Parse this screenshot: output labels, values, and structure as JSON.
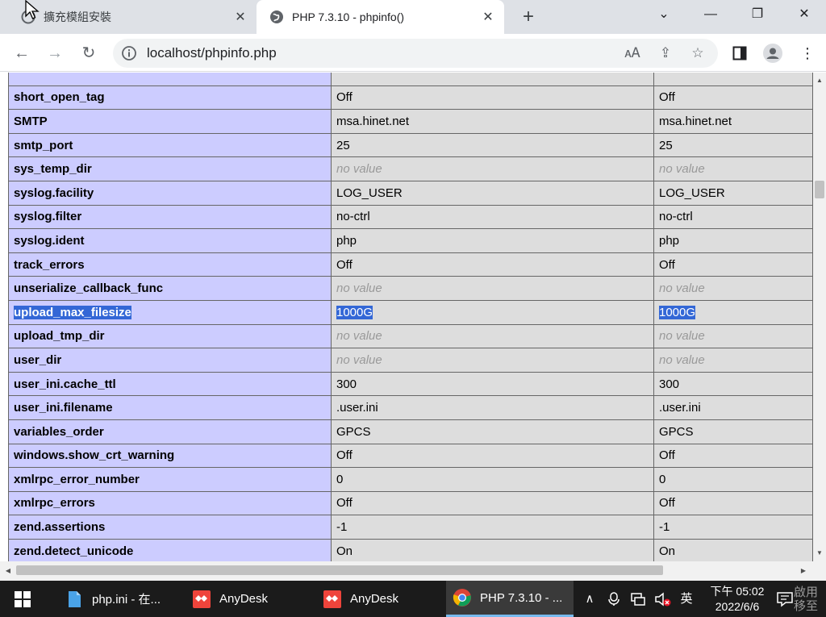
{
  "browser": {
    "tabs": [
      {
        "title": "擴充模組安裝",
        "active": false
      },
      {
        "title": "PHP 7.3.10 - phpinfo()",
        "active": true
      }
    ],
    "url": "localhost/phpinfo.php"
  },
  "colors": {
    "directive_bg": "#ccccff",
    "value_bg": "#dddddd",
    "selection": "#3367d6",
    "taskbar": "#1b1b1b"
  },
  "phpinfo": {
    "rows": [
      {
        "directive": "",
        "local": "",
        "master": ""
      },
      {
        "directive": "short_open_tag",
        "local": "Off",
        "master": "Off"
      },
      {
        "directive": "SMTP",
        "local": "msa.hinet.net",
        "master": "msa.hinet.net"
      },
      {
        "directive": "smtp_port",
        "local": "25",
        "master": "25"
      },
      {
        "directive": "sys_temp_dir",
        "local": "no value",
        "master": "no value"
      },
      {
        "directive": "syslog.facility",
        "local": "LOG_USER",
        "master": "LOG_USER"
      },
      {
        "directive": "syslog.filter",
        "local": "no-ctrl",
        "master": "no-ctrl"
      },
      {
        "directive": "syslog.ident",
        "local": "php",
        "master": "php"
      },
      {
        "directive": "track_errors",
        "local": "Off",
        "master": "Off"
      },
      {
        "directive": "unserialize_callback_func",
        "local": "no value",
        "master": "no value"
      },
      {
        "directive": "upload_max_filesize",
        "local": "1000G",
        "master": "1000G"
      },
      {
        "directive": "upload_tmp_dir",
        "local": "no value",
        "master": "no value"
      },
      {
        "directive": "user_dir",
        "local": "no value",
        "master": "no value"
      },
      {
        "directive": "user_ini.cache_ttl",
        "local": "300",
        "master": "300"
      },
      {
        "directive": "user_ini.filename",
        "local": ".user.ini",
        "master": ".user.ini"
      },
      {
        "directive": "variables_order",
        "local": "GPCS",
        "master": "GPCS"
      },
      {
        "directive": "windows.show_crt_warning",
        "local": "Off",
        "master": "Off"
      },
      {
        "directive": "xmlrpc_error_number",
        "local": "0",
        "master": "0"
      },
      {
        "directive": "xmlrpc_errors",
        "local": "Off",
        "master": "Off"
      },
      {
        "directive": "zend.assertions",
        "local": "-1",
        "master": "-1"
      },
      {
        "directive": "zend.detect_unicode",
        "local": "On",
        "master": "On"
      },
      {
        "directive": "",
        "local": "",
        "master": ""
      }
    ]
  },
  "taskbar": {
    "apps": [
      {
        "label": "php.ini - 在...",
        "icon": "file-icon"
      },
      {
        "label": "AnyDesk",
        "icon": "anydesk-icon"
      },
      {
        "label": "AnyDesk",
        "icon": "anydesk-icon"
      },
      {
        "label": "PHP 7.3.10 - ...",
        "icon": "chrome-icon",
        "active": true
      }
    ],
    "ime": "英",
    "clock_time": "下午 05:02",
    "clock_date": "2022/6/6",
    "watermark_line1": "啟用",
    "watermark_line2": "移至"
  }
}
